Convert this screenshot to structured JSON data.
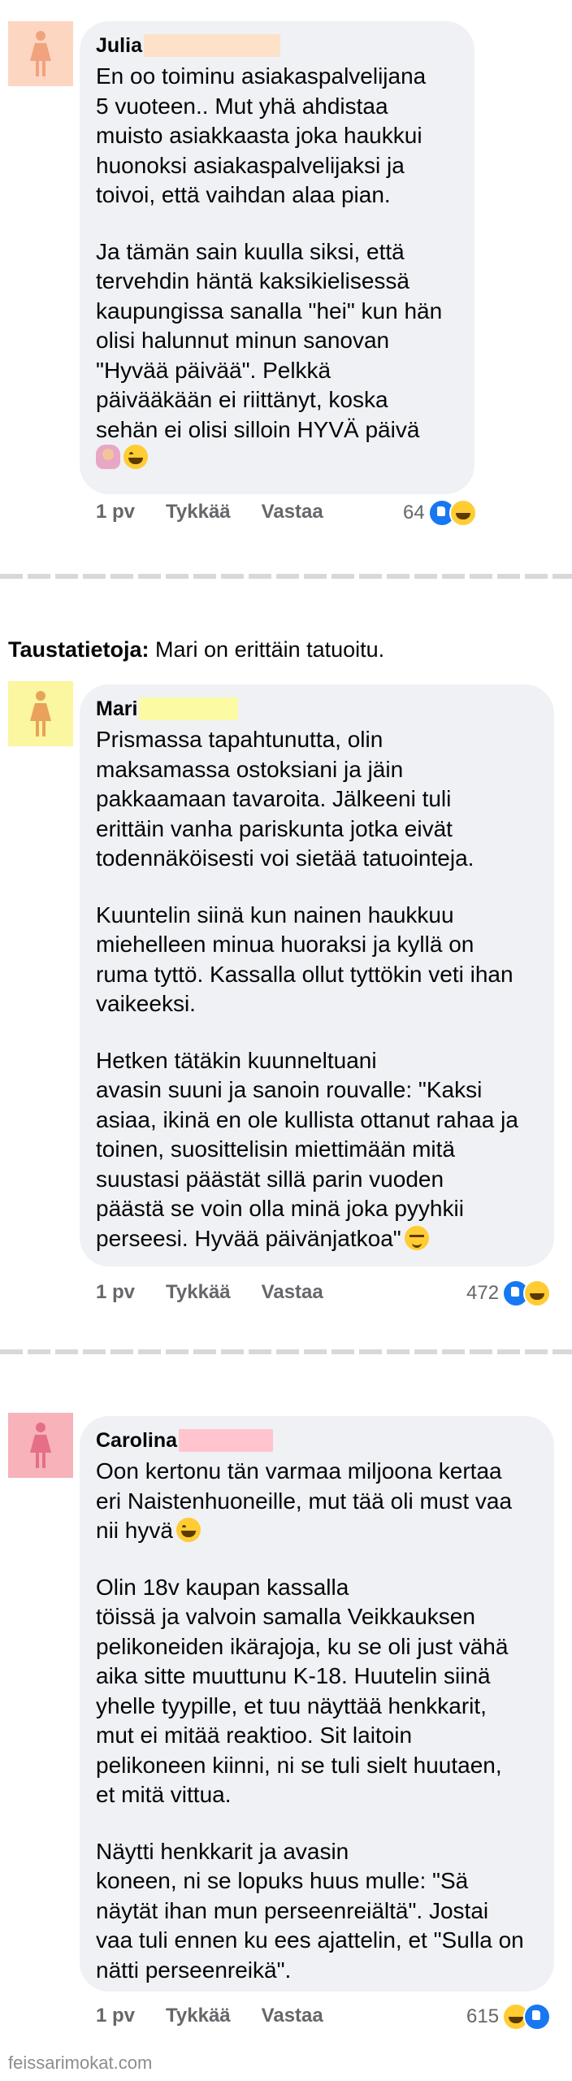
{
  "colors": {
    "bubble": "#eff1f4",
    "avatar_julia": "#fdd6c2",
    "avatar_mari": "#fbf6a0",
    "avatar_carolina": "#f7b2ba",
    "icon_julia": "#f0a37e",
    "icon_mari": "#e8a25a",
    "icon_carolina": "#e46f86",
    "mask_julia": "#fde1c9",
    "mask_mari": "#fdfaa4",
    "mask_carolina": "#ffc4ce",
    "meta_text": "#65676b",
    "like_blue": "#1877f2"
  },
  "comments": [
    {
      "name": "Julia",
      "paragraphs": [
        "En oo toiminu asiakaspalvelijana\n5 vuoteen.. Mut yhä ahdistaa\nmuisto asiakkaasta joka haukkui\nhuonoksi asiakaspalvelijaksi ja\ntoivoi, että vaihdan alaa pian.",
        "Ja tämän sain kuulla siksi, että\ntervehdin häntä kaksikielisessä\nkaupungissa sanalla \"hei\" kun hän\nolisi halunnut minun sanovan\n\"Hyvää päivää\". Pelkkä\npäivääkään ei riittänyt, koska\nsehän ei olisi silloin HYVÄ päivä"
      ],
      "time": "1 pv",
      "like_label": "Tykkää",
      "reply_label": "Vastaa",
      "reaction_count": "64"
    },
    {
      "name": "Mari",
      "paragraphs": [
        "Prismassa tapahtunutta, olin\nmaksamassa ostoksiani ja jäin\npakkaamaan tavaroita. Jälkeeni tuli\nerittäin vanha pariskunta jotka eivät\ntodennäköisesti voi sietää tatuointeja.",
        "Kuuntelin siinä kun nainen haukkuu\nmiehelleen minua huoraksi ja kyllä on\nruma tyttö. Kassalla ollut tyttökin veti ihan\nvaikeeksi.",
        "Hetken tätäkin kuunneltuani\navasin suuni ja sanoin rouvalle: \"Kaksi\nasiaa, ikinä en ole kullista ottanut rahaa ja\ntoinen, suosittelisin miettimään mitä\nsuustasi päästät sillä parin vuoden\npäästä se voin olla minä joka pyyhkii\nperseesi. Hyvää päivänjatkoa\""
      ],
      "time": "1 pv",
      "like_label": "Tykkää",
      "reply_label": "Vastaa",
      "reaction_count": "472"
    },
    {
      "name": "Carolina",
      "paragraphs": [
        "Oon kertonu tän varmaa miljoona kertaa\neri Naistenhuoneille, mut tää oli must vaa\nnii hyvä",
        "Olin 18v kaupan kassalla\ntöissä ja valvoin samalla Veikkauksen\npelikoneiden ikärajoja, ku se oli just vähä\naika sitte muuttunu K-18. Huutelin siinä\nyhelle tyypille, et tuu näyttää henkkarit,\nmut ei mitää reaktioo. Sit laitoin\npelikoneen kiinni, ni se tuli sielt huutaen,\net mitä vittua.",
        "Näytti henkkarit ja avasin\nkoneen, ni se lopuks huus mulle: \"Sä\nnäytät ihan mun perseenreiältä\". Jostai\nvaa tuli ennen ku ees ajattelin, et \"Sulla on\nnätti perseenreikä\"."
      ],
      "time": "1 pv",
      "like_label": "Tykkää",
      "reply_label": "Vastaa",
      "reaction_count": "615"
    }
  ],
  "context": {
    "label": "Taustatietoja:",
    "text": " Mari on erittäin tatuoitu."
  },
  "watermark": "feissarimokat.com",
  "icons": {
    "avatar": "person-icon",
    "emoji_laugh": "laughing-emoji-icon",
    "emoji_shrug": "woman-shrugging-emoji-icon",
    "emoji_relieved": "relieved-emoji-icon",
    "reaction_like": "like-reaction-icon",
    "reaction_haha": "haha-reaction-icon"
  }
}
